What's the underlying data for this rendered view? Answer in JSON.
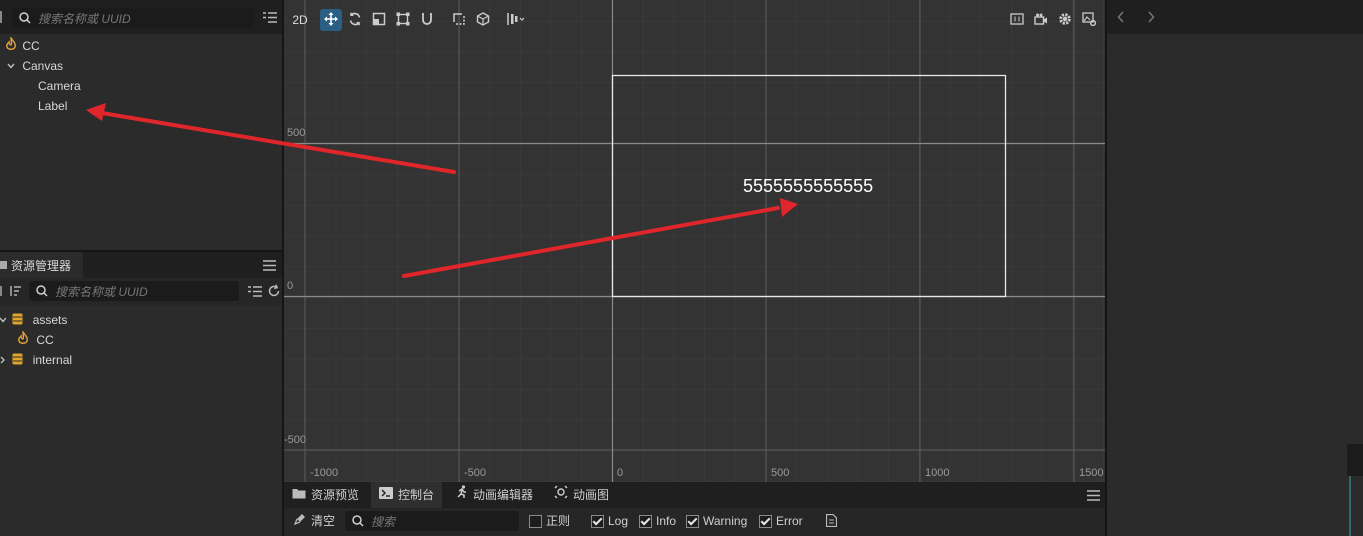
{
  "hierarchy": {
    "search_placeholder": "搜索名称或 UUID",
    "nodes": [
      "CC",
      "Canvas",
      "Camera",
      "Label"
    ]
  },
  "assets": {
    "title": "资源管理器",
    "search_placeholder": "搜索名称或 UUID",
    "items": [
      "assets",
      "CC",
      "internal"
    ]
  },
  "scene": {
    "mode_label": "2D",
    "label_text": "5555555555555",
    "y_axis": [
      "500",
      "0",
      "-500"
    ],
    "x_axis": [
      "-1000",
      "-500",
      "0",
      "500",
      "1000",
      "1500"
    ]
  },
  "console": {
    "tabs": [
      "资源预览",
      "控制台",
      "动画编辑器",
      "动画图"
    ],
    "clear_label": "清空",
    "search_placeholder": "搜索",
    "filters": [
      {
        "label": "正则",
        "checked": false
      },
      {
        "label": "Log",
        "checked": true
      },
      {
        "label": "Info",
        "checked": true
      },
      {
        "label": "Warning",
        "checked": true
      },
      {
        "label": "Error",
        "checked": true
      }
    ]
  },
  "colors": {
    "accent": "#2a5f84",
    "annotation_arrow": "#e0262a",
    "grid_major": "#5a5a5a"
  }
}
